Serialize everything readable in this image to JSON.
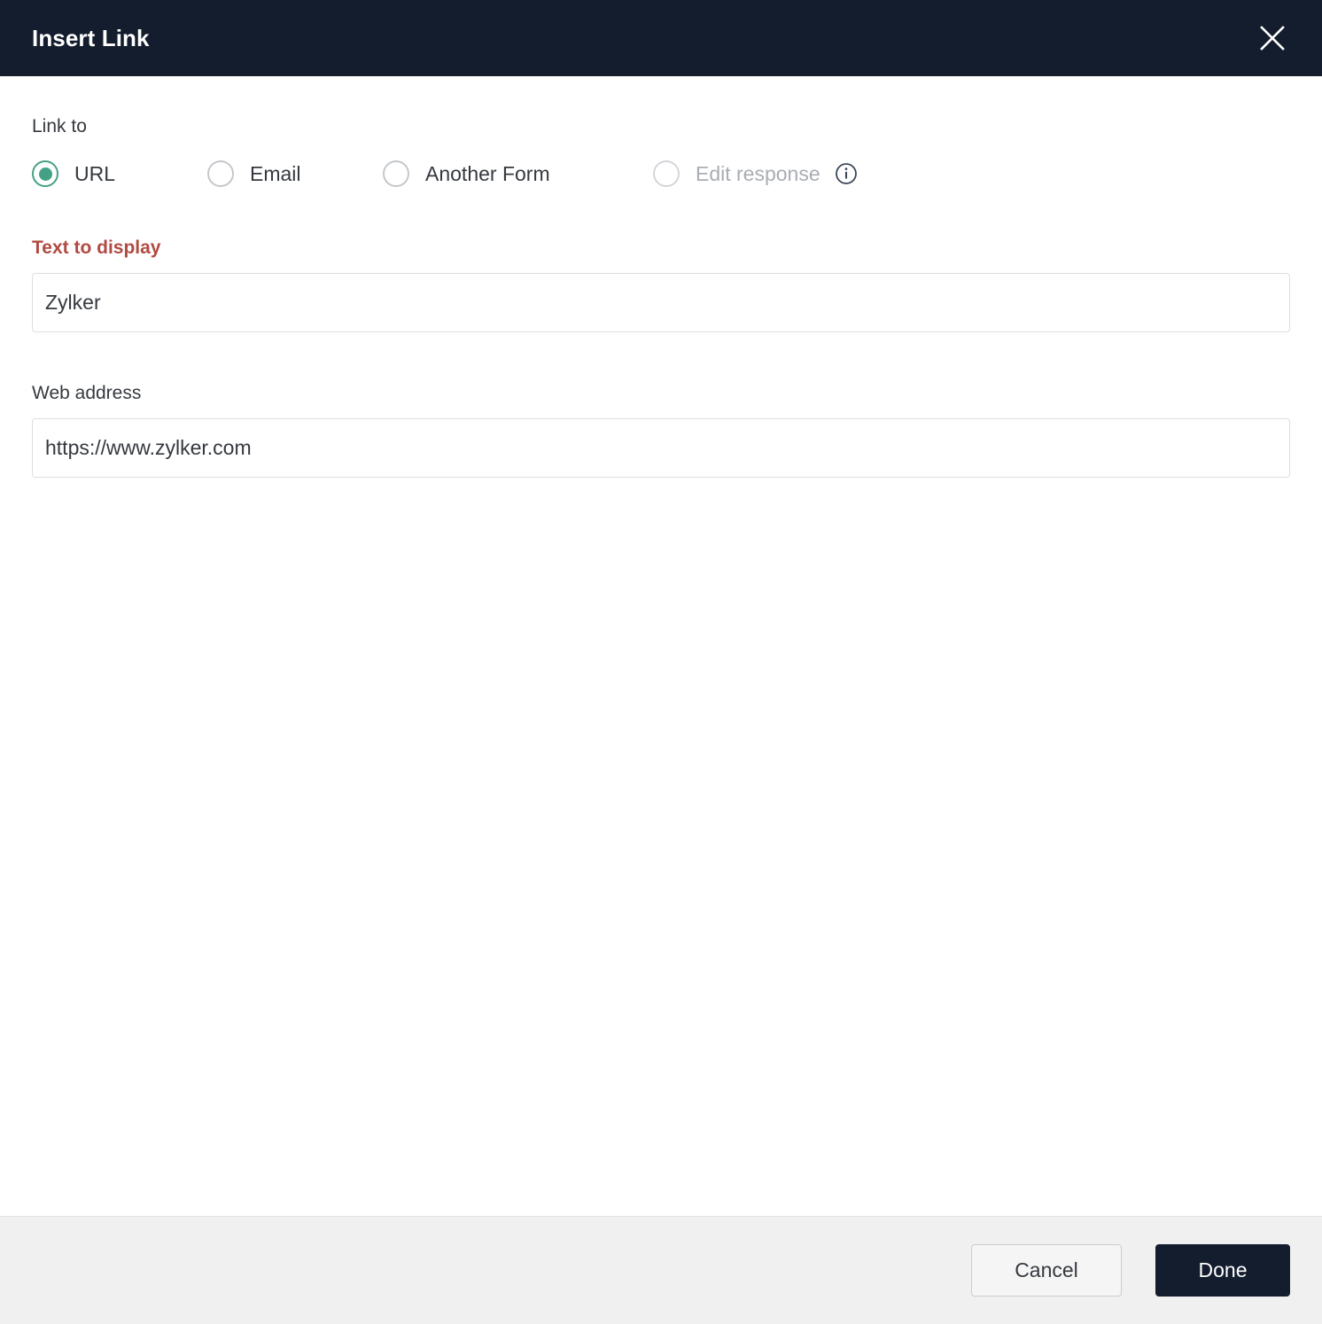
{
  "header": {
    "title": "Insert Link",
    "close_icon": "close-icon"
  },
  "body": {
    "link_to": {
      "label": "Link to",
      "options": [
        {
          "label": "URL",
          "selected": true,
          "disabled": false
        },
        {
          "label": "Email",
          "selected": false,
          "disabled": false
        },
        {
          "label": "Another Form",
          "selected": false,
          "disabled": false
        },
        {
          "label": "Edit response",
          "selected": false,
          "disabled": true,
          "info_icon": "info-icon"
        }
      ]
    },
    "text_to_display": {
      "label": "Text to display",
      "value": "Zylker",
      "placeholder": "Text to display",
      "state": "error"
    },
    "web_address": {
      "label": "Web address",
      "value": "https://www.zylker.com",
      "placeholder": "Web address",
      "state": "normal"
    }
  },
  "footer": {
    "cancel_label": "Cancel",
    "done_label": "Done"
  },
  "colors": {
    "header_bg": "#141d2e",
    "accent_radio": "#45a186",
    "error_label": "#b14a42",
    "footer_bg": "#f0f0f0",
    "primary_button_bg": "#141d2e",
    "body_text": "#35393f",
    "disabled_text": "#a9adb4",
    "input_border": "#dcdee1"
  }
}
